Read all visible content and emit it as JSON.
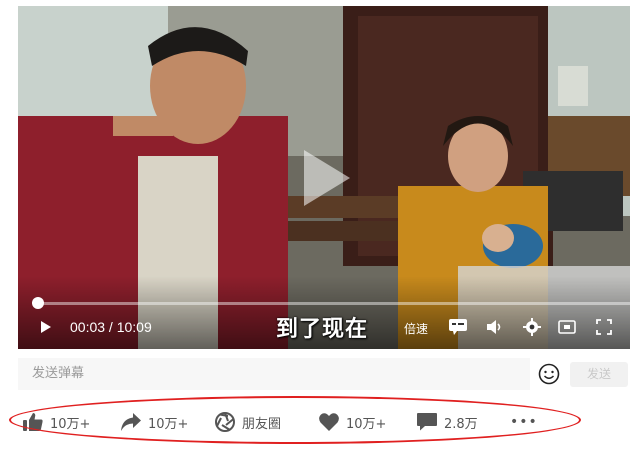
{
  "video": {
    "current_time": "00:03",
    "duration": "10:09",
    "time_sep": " / ",
    "subtitle": "到了现在",
    "speed_label": "倍速",
    "progress": 0.005
  },
  "danmaku": {
    "placeholder": "发送弹幕",
    "send_label": "发送"
  },
  "actions": {
    "like_count": "10万+",
    "share_count": "10万+",
    "moments_label": "朋友圈",
    "favorite_count": "10万+",
    "comment_count": "2.8万",
    "more_label": "•••"
  },
  "colors": {
    "highlight": "#e02020",
    "icon_gray": "#555555"
  }
}
